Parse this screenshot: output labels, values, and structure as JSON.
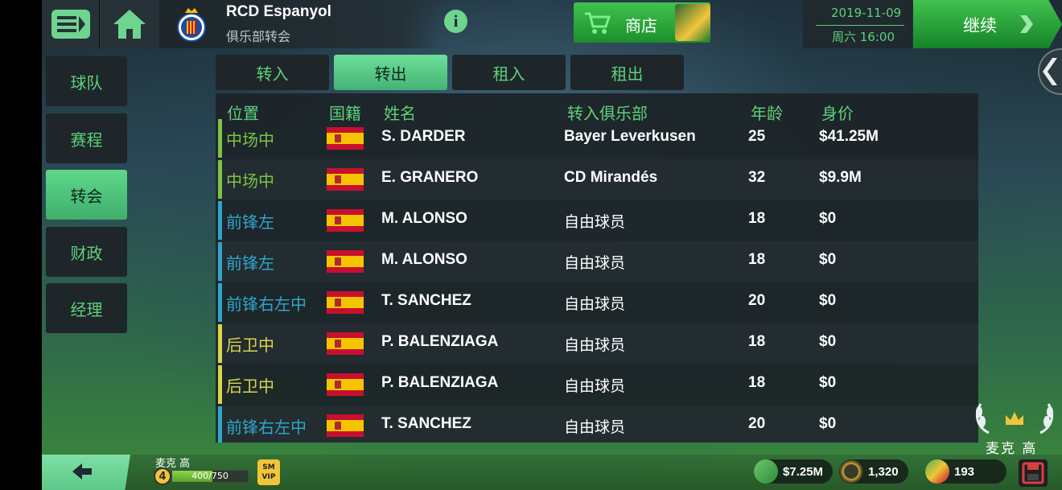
{
  "header": {
    "club_name": "RCD Espanyol",
    "club_subtitle": "俱乐部转会",
    "info_label": "i",
    "shop_label": "商店",
    "date": "2019-11-09",
    "day_time": "周六 16:00",
    "continue_label": "继续"
  },
  "nav": {
    "items": [
      {
        "label": "球队"
      },
      {
        "label": "赛程"
      },
      {
        "label": "转会"
      },
      {
        "label": "财政"
      },
      {
        "label": "经理"
      }
    ],
    "active": "转会"
  },
  "tabs": [
    {
      "label": "转入"
    },
    {
      "label": "转出"
    },
    {
      "label": "租入"
    },
    {
      "label": "租出"
    }
  ],
  "active_tab": "转出",
  "table": {
    "headers": {
      "position": "位置",
      "nationality": "国籍",
      "name": "姓名",
      "club": "转入俱乐部",
      "age": "年龄",
      "value": "身价"
    },
    "rows": [
      {
        "position": "中场中",
        "pos_color": "#7cc444",
        "flag": "spain-flag",
        "name": "S. DARDER",
        "club": "Bayer Leverkusen",
        "age": "25",
        "value": "$41.25M"
      },
      {
        "position": "中场中",
        "pos_color": "#7cc444",
        "flag": "spain-flag",
        "name": "E. GRANERO",
        "club": "CD Mirandés",
        "age": "32",
        "value": "$9.9M"
      },
      {
        "position": "前锋左",
        "pos_color": "#2fa6c9",
        "flag": "spain-flag",
        "name": "M. ALONSO",
        "club": "自由球员",
        "age": "18",
        "value": "$0"
      },
      {
        "position": "前锋左",
        "pos_color": "#2fa6c9",
        "flag": "spain-flag",
        "name": "M. ALONSO",
        "club": "自由球员",
        "age": "18",
        "value": "$0"
      },
      {
        "position": "前锋右左中",
        "pos_color": "#2fa6c9",
        "flag": "spain-flag",
        "name": "T. SANCHEZ",
        "club": "自由球员",
        "age": "20",
        "value": "$0"
      },
      {
        "position": "后卫中",
        "pos_color": "#d9d54a",
        "flag": "spain-flag",
        "name": "P. BALENZIAGA",
        "club": "自由球员",
        "age": "18",
        "value": "$0"
      },
      {
        "position": "后卫中",
        "pos_color": "#d9d54a",
        "flag": "spain-flag",
        "name": "P. BALENZIAGA",
        "club": "自由球员",
        "age": "18",
        "value": "$0"
      },
      {
        "position": "前锋右左中",
        "pos_color": "#2fa6c9",
        "flag": "spain-flag",
        "name": "T. SANCHEZ",
        "club": "自由球员",
        "age": "20",
        "value": "$0"
      }
    ]
  },
  "footer": {
    "manager_name": "麦克 高",
    "level": "4",
    "xp": "400/750",
    "xp_fraction": 0.533,
    "vip_label": "SM VIP",
    "money": "$7.25M",
    "coins": "1,320",
    "tokens": "193",
    "trophy_name": "麦克 高"
  },
  "colors": {
    "accent": "#5fd17a",
    "button_green": "#2ca83e",
    "panel": "#1e262a"
  }
}
